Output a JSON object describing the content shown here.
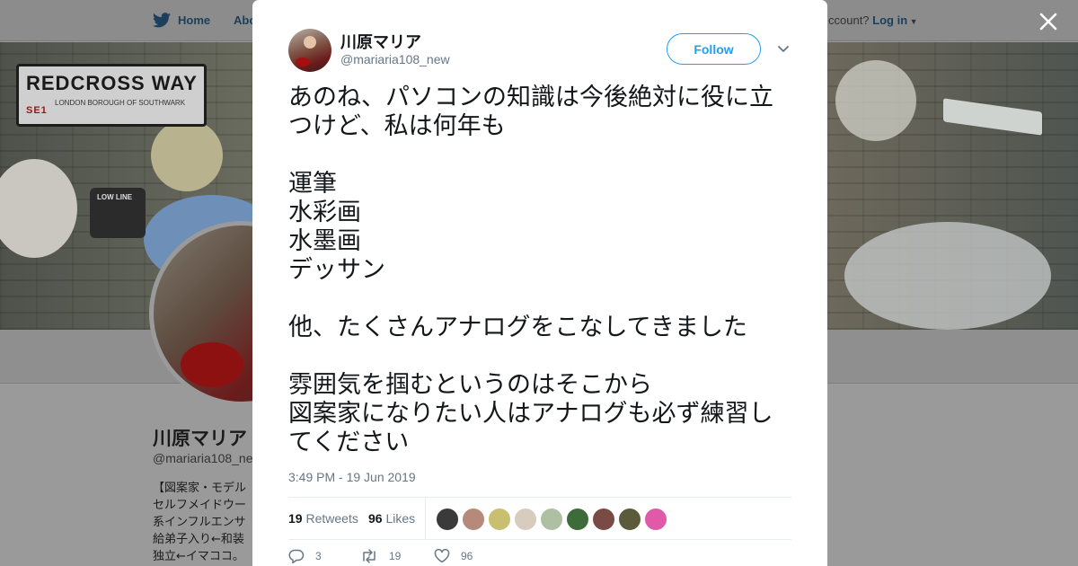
{
  "nav": {
    "home_label": "Home",
    "about_label": "Abo",
    "account_prompt": "ccount?",
    "login_label": "Log in"
  },
  "banner": {
    "sign_text": "REDCROSS WAY",
    "sign_suffix": "SE1",
    "sign_sub": "LONDON BOROUGH OF SOUTHWARK",
    "lowline_text": "LOW LINE"
  },
  "profile": {
    "name": "川原マリア",
    "handle": "@mariaria108_ne",
    "bio_lines": [
      "【図案家・モデル",
      "セルフメイドウー",
      "系インフルエンサ",
      "給弟子入り←和装",
      "独立←イマココ。"
    ]
  },
  "tweet": {
    "author_name": "川原マリア",
    "author_handle": "@mariaria108_new",
    "follow_label": "Follow",
    "body_lines": [
      "あのね、パソコンの知識は今後絶対に役に立",
      "つけど、私は何年も",
      "",
      "運筆",
      "水彩画",
      "水墨画",
      "デッサン",
      "",
      "他、たくさんアナログをこなしてきました",
      "",
      "雰囲気を掴むというのはそこから",
      "図案家になりたい人はアナログも必ず練習し",
      "てください"
    ],
    "timestamp": "3:49 PM - 19 Jun 2019",
    "retweets_count": "19",
    "retweets_label": "Retweets",
    "likes_count": "96",
    "likes_label": "Likes",
    "reply_count": "3",
    "retweet_action_count": "19",
    "like_action_count": "96"
  },
  "likers_colors": [
    "#3a3a3a",
    "#b58a7a",
    "#c8c070",
    "#d8ccbe",
    "#aebfa2",
    "#3d6b3a",
    "#7a4a44",
    "#5b5a3a",
    "#e05aa8"
  ],
  "colors": {
    "accent": "#1da1f2",
    "text": "#14171a",
    "muted": "#657786"
  }
}
